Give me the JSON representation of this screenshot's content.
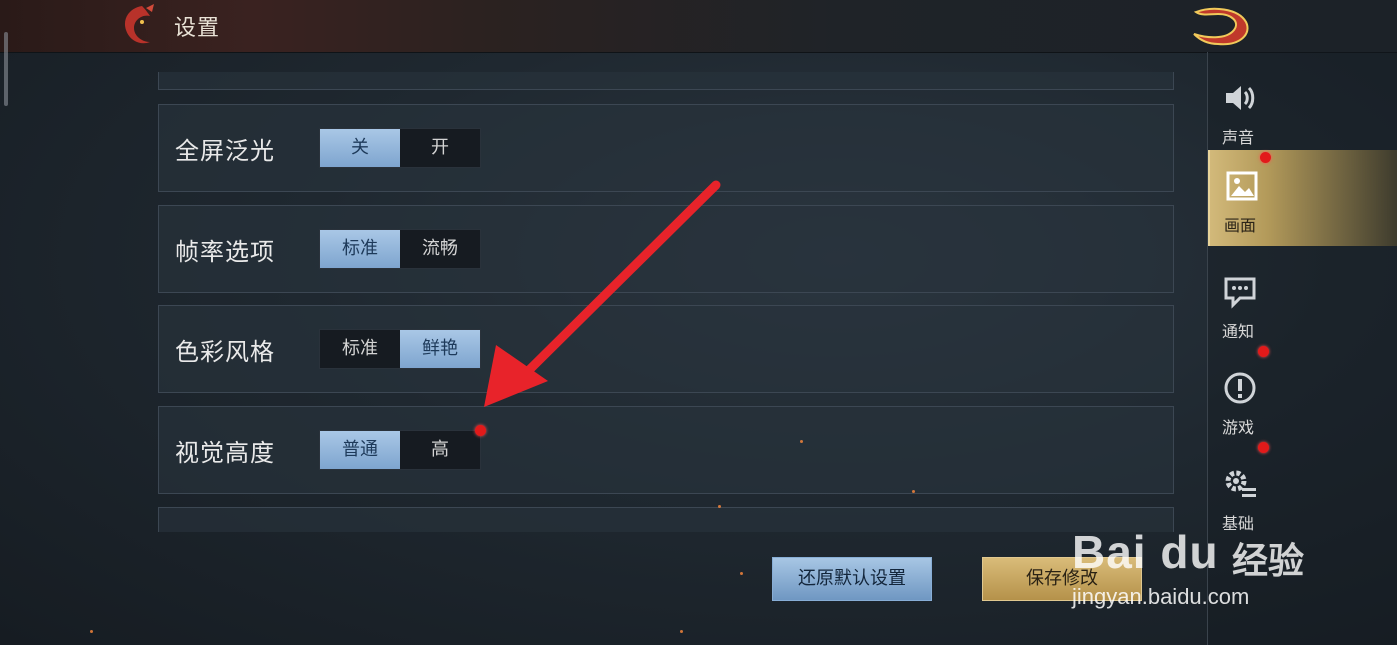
{
  "header": {
    "title": "设置"
  },
  "settings": [
    {
      "label": "全屏泛光",
      "options": [
        "关",
        "开"
      ],
      "selected": 0
    },
    {
      "label": "帧率选项",
      "options": [
        "标准",
        "流畅"
      ],
      "selected": 0
    },
    {
      "label": "色彩风格",
      "options": [
        "标准",
        "鲜艳"
      ],
      "selected": 1
    },
    {
      "label": "视觉高度",
      "options": [
        "普通",
        "高"
      ],
      "selected": 0
    }
  ],
  "sidebar": {
    "items": [
      {
        "label": "声音",
        "icon": "speaker-icon"
      },
      {
        "label": "画面",
        "icon": "image-icon",
        "active": true
      },
      {
        "label": "通知",
        "icon": "chat-icon"
      },
      {
        "label": "游戏",
        "icon": "alert-icon"
      },
      {
        "label": "基础",
        "icon": "gear-icon"
      }
    ]
  },
  "buttons": {
    "reset": "还原默认设置",
    "save": "保存修改"
  },
  "watermark": {
    "brand": "Bai du",
    "cn": "经验",
    "url": "jingyan.baidu.com"
  },
  "colors": {
    "accent_blue": "#8fb3d9",
    "accent_gold": "#c9ad6b",
    "alert_red": "#e21a1a",
    "arrow_red": "#e8232a"
  }
}
